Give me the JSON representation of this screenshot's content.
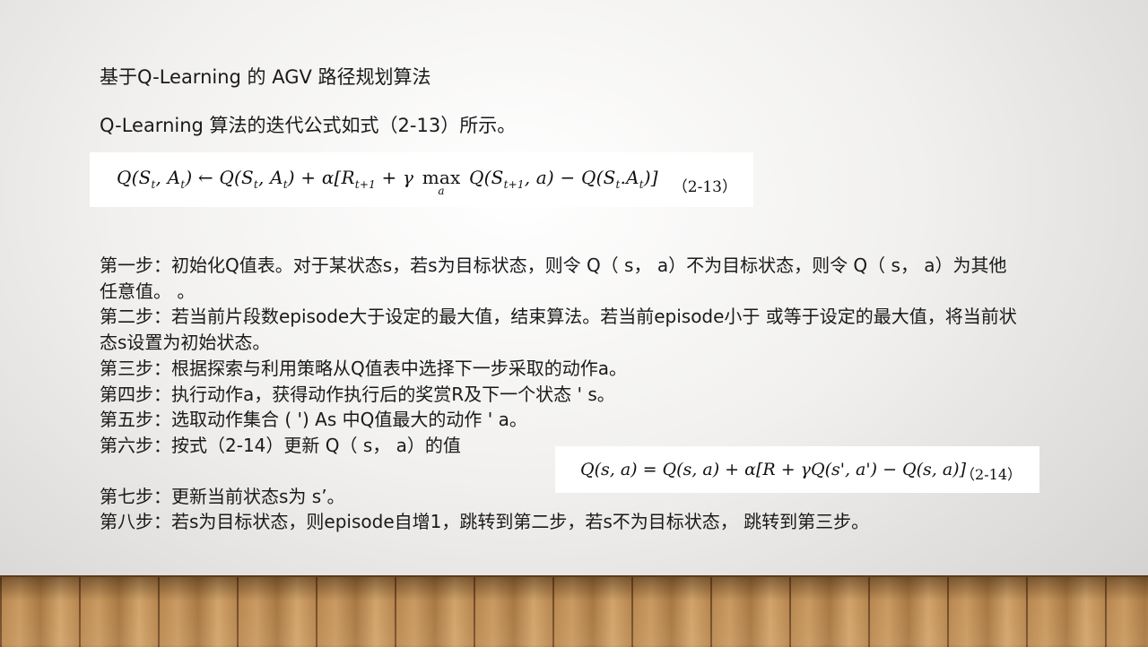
{
  "heading": "基于Q-Learning 的 AGV 路径规划算法",
  "intro": "Q-Learning 算法的迭代公式如式（2-13）所示。",
  "formula1": {
    "number": "（2-13）"
  },
  "formula2": {
    "number": "（2-14）"
  },
  "steps": [
    "第一步：初始化Q值表。对于某状态s，若s为目标状态，则令 Q（ s， a）不为目标状态，则令 Q（ s， a）为其他任意值。 。",
    "第二步：若当前片段数episode大于设定的最大值，结束算法。若当前episode小于 或等于设定的最大值，将当前状态s设置为初始状态。",
    "第三步：根据探索与利用策略从Q值表中选择下一步采取的动作a。",
    "第四步：执行动作a，获得动作执行后的奖赏R及下一个状态 ' s。",
    "第五步：选取动作集合 ( ') As 中Q值最大的动作 ' a。",
    "第六步：按式（2-14）更新 Q（ s， a）的值",
    "第七步：更新当前状态s为 s’。",
    "第八步：若s为目标状态，则episode自增1，跳转到第二步，若s不为目标状态， 跳转到第三步。"
  ]
}
